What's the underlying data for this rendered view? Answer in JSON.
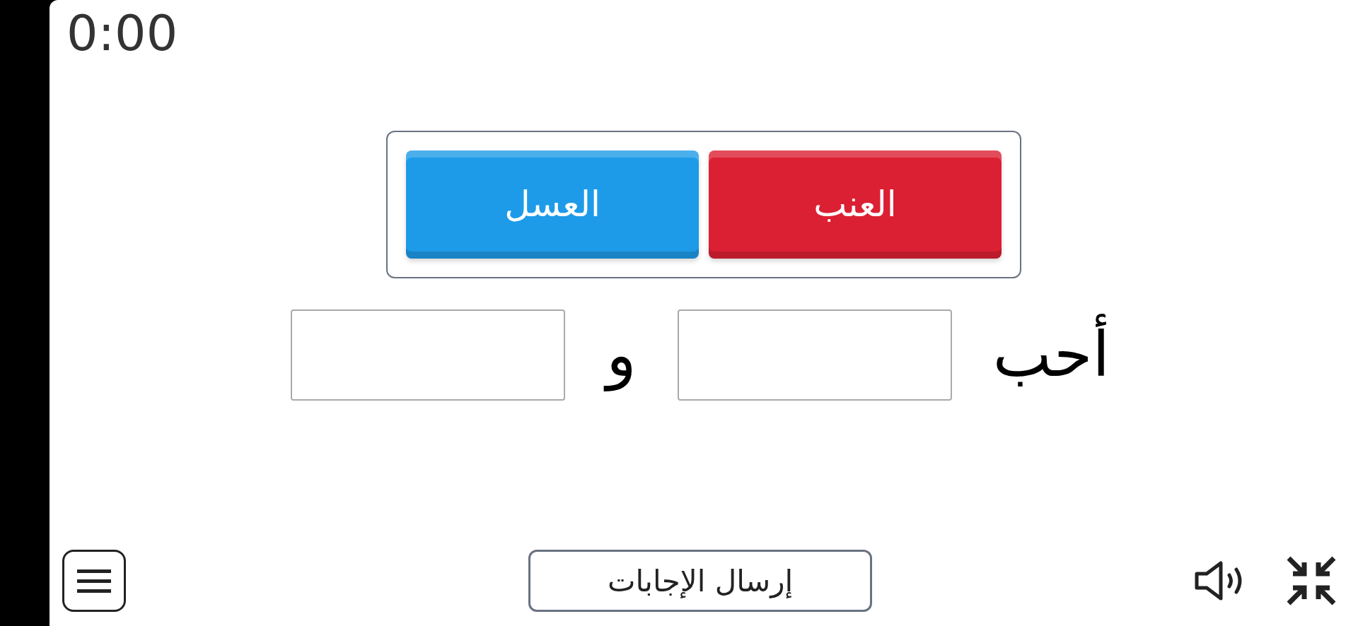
{
  "timer": "0:00",
  "word_bank": [
    {
      "text": "العنب",
      "color": "#dc2033"
    },
    {
      "text": "العسل",
      "color": "#1e9be8"
    }
  ],
  "sentence": [
    {
      "kind": "text",
      "text": "أحب"
    },
    {
      "kind": "blank"
    },
    {
      "kind": "text",
      "text": "و"
    },
    {
      "kind": "blank"
    }
  ],
  "submit": "إرسال الإجابات"
}
